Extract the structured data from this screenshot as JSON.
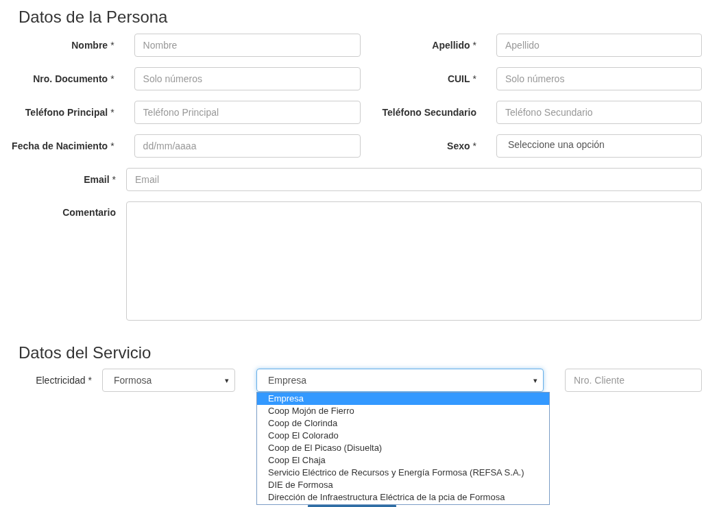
{
  "persona": {
    "title": "Datos de la Persona",
    "rows": [
      [
        {
          "kind": "text",
          "label": "Nombre",
          "mark": "*",
          "placeholder": "Nombre"
        },
        {
          "kind": "text",
          "label": "Apellido",
          "mark": "*",
          "placeholder": "Apellido"
        }
      ],
      [
        {
          "kind": "text",
          "label": "Nro. Documento",
          "mark": "*",
          "placeholder": "Solo números"
        },
        {
          "kind": "text",
          "label": "CUIL",
          "mark": "*",
          "placeholder": "Solo números"
        }
      ],
      [
        {
          "kind": "text",
          "label": "Teléfono Principal",
          "mark": "*",
          "placeholder": "Teléfono Principal"
        },
        {
          "kind": "text",
          "label": "Teléfono Secundario",
          "placeholder": "Teléfono Secundario"
        }
      ],
      [
        {
          "kind": "text",
          "label": "Fecha de Nacimiento",
          "mark": "*",
          "placeholder": "dd/mm/aaaa"
        },
        {
          "kind": "select",
          "label": "Sexo",
          "mark": "*",
          "value": "Seleccione una opción"
        }
      ],
      [
        {
          "kind": "wide",
          "label": "Email",
          "mark": "*",
          "placeholder": "Email"
        }
      ],
      [
        {
          "kind": "textarea",
          "label": "Comentario"
        }
      ]
    ]
  },
  "servicio": {
    "title": "Datos del Servicio",
    "label": "Electricidad",
    "mark": "*",
    "province_select": {
      "value": "Formosa",
      "arrow": "▾"
    },
    "company_select": {
      "value": "Empresa",
      "arrow": "▾",
      "focused": true,
      "expanded": true,
      "options": [
        {
          "label": "Empresa",
          "selected": true
        },
        {
          "label": "Coop Mojón de Fierro",
          "selected": false
        },
        {
          "label": "Coop de Clorinda",
          "selected": false
        },
        {
          "label": "Coop El Colorado",
          "selected": false
        },
        {
          "label": "Coop de El Picaso (Disuelta)",
          "selected": false
        },
        {
          "label": "Coop El Chaja",
          "selected": false
        },
        {
          "label": "Servicio Eléctrico de Recursos y Energía Formosa (REFSA S.A.)",
          "selected": false
        },
        {
          "label": "DIE de Formosa",
          "selected": false
        },
        {
          "label": "Dirección de Infraestructura Eléctrica de la pcia de Formosa",
          "selected": false
        }
      ]
    },
    "client_field": {
      "placeholder": "Nro. Cliente"
    }
  }
}
